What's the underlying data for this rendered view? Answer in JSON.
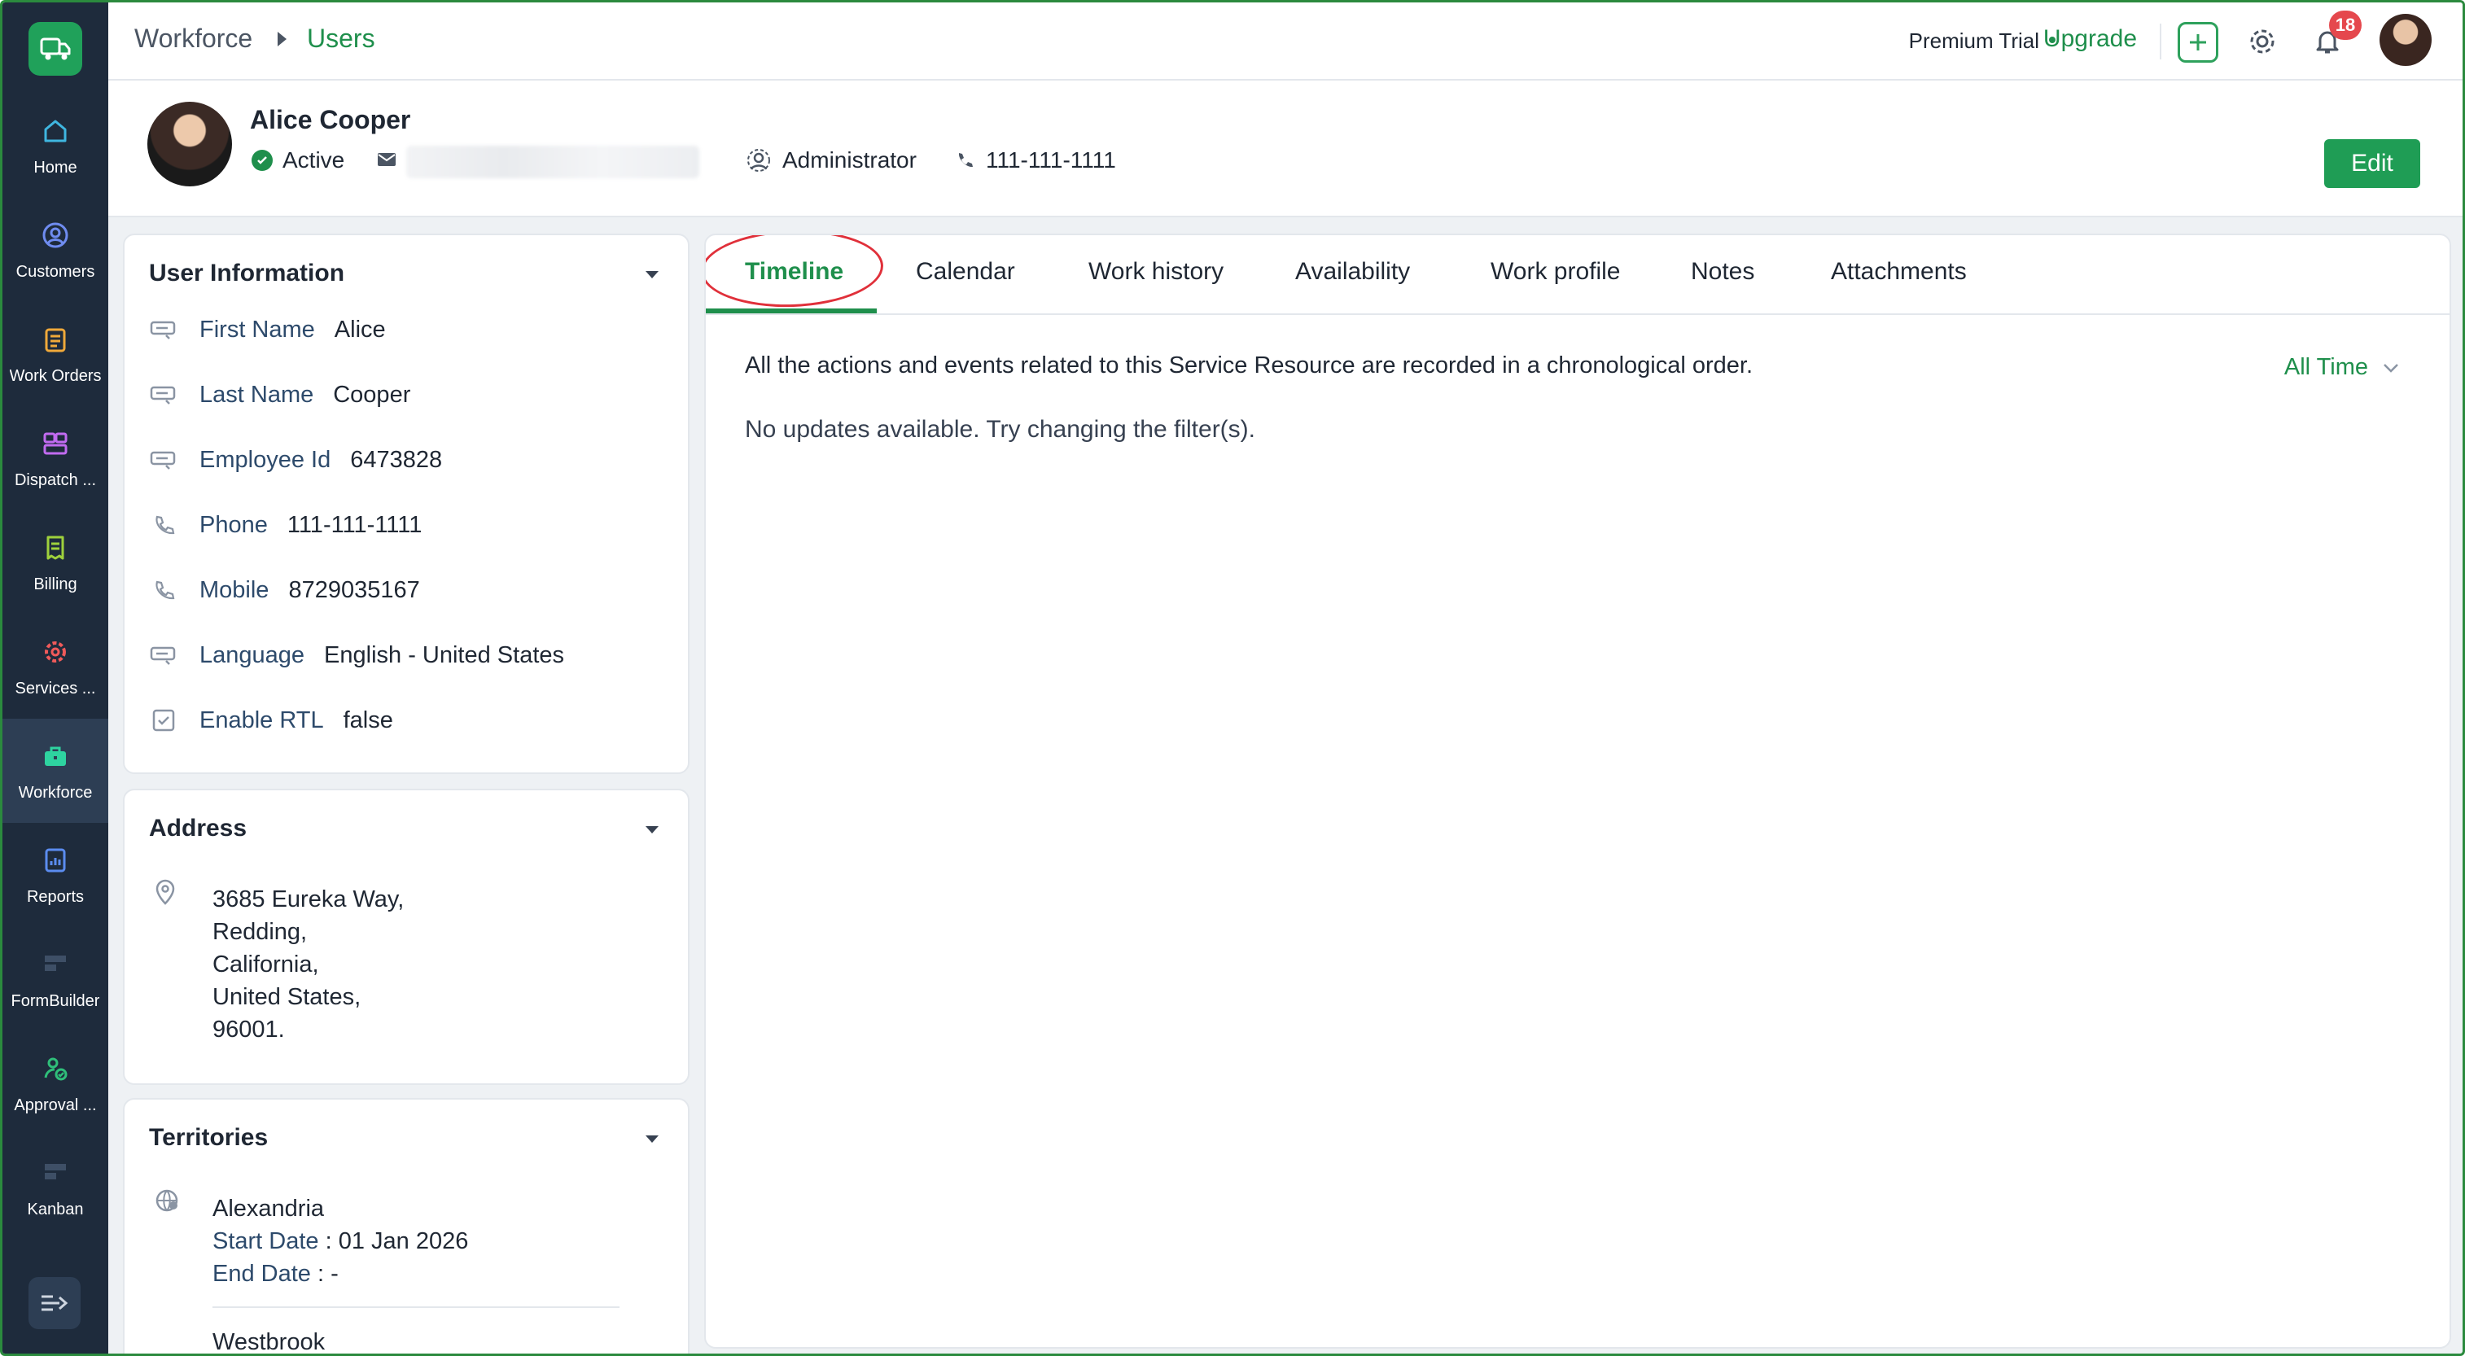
{
  "sidebar": {
    "items": [
      {
        "label": "Home",
        "icon": "home-icon"
      },
      {
        "label": "Customers",
        "icon": "customers-icon"
      },
      {
        "label": "Work Orders",
        "icon": "work-orders-icon"
      },
      {
        "label": "Dispatch ...",
        "icon": "dispatch-icon"
      },
      {
        "label": "Billing",
        "icon": "billing-icon"
      },
      {
        "label": "Services ...",
        "icon": "services-icon"
      },
      {
        "label": "Workforce",
        "icon": "workforce-icon"
      },
      {
        "label": "Reports",
        "icon": "reports-icon"
      },
      {
        "label": "FormBuilder",
        "icon": "formbuilder-icon"
      },
      {
        "label": "Approval ...",
        "icon": "approval-icon"
      },
      {
        "label": "Kanban",
        "icon": "kanban-icon"
      }
    ],
    "active": "Workforce"
  },
  "topbar": {
    "breadcrumb_root": "Workforce",
    "breadcrumb_current": "Users",
    "plan": "Premium Trial",
    "upgrade": "Upgrade",
    "notification_count": "18"
  },
  "profile": {
    "name": "Alice Cooper",
    "status": "Active",
    "role": "Administrator",
    "phone": "111-111-1111",
    "edit_label": "Edit"
  },
  "user_info": {
    "title": "User Information",
    "fields": [
      {
        "label": "First Name",
        "value": "Alice"
      },
      {
        "label": "Last Name",
        "value": "Cooper"
      },
      {
        "label": "Employee Id",
        "value": "6473828"
      },
      {
        "label": "Phone",
        "value": "111-111-1111"
      },
      {
        "label": "Mobile",
        "value": "8729035167"
      },
      {
        "label": "Language",
        "value": "English - United States"
      },
      {
        "label": "Enable RTL",
        "value": "false"
      }
    ]
  },
  "address": {
    "title": "Address",
    "lines": [
      "3685 Eureka Way,",
      "Redding,",
      "California,",
      "United States,",
      "96001."
    ]
  },
  "territories": {
    "title": "Territories",
    "items": [
      {
        "name": "Alexandria",
        "start_label": "Start Date",
        "start_value": " : 01 Jan 2026",
        "end_label": "End Date",
        "end_value": " : -"
      },
      {
        "name": "Westbrook"
      }
    ]
  },
  "main": {
    "tabs": [
      "Timeline",
      "Calendar",
      "Work history",
      "Availability",
      "Work profile",
      "Notes",
      "Attachments"
    ],
    "active_tab": "Timeline",
    "description": "All the actions and events related to this Service Resource are recorded in a chronological order.",
    "empty_message": "No updates available. Try changing the filter(s).",
    "filter_label": "All Time"
  },
  "colors": {
    "accent": "#1f8f4c",
    "sidebar_bg": "#1e2b3c",
    "annotation_circle": "#e0303a",
    "badge": "#e5484d"
  }
}
